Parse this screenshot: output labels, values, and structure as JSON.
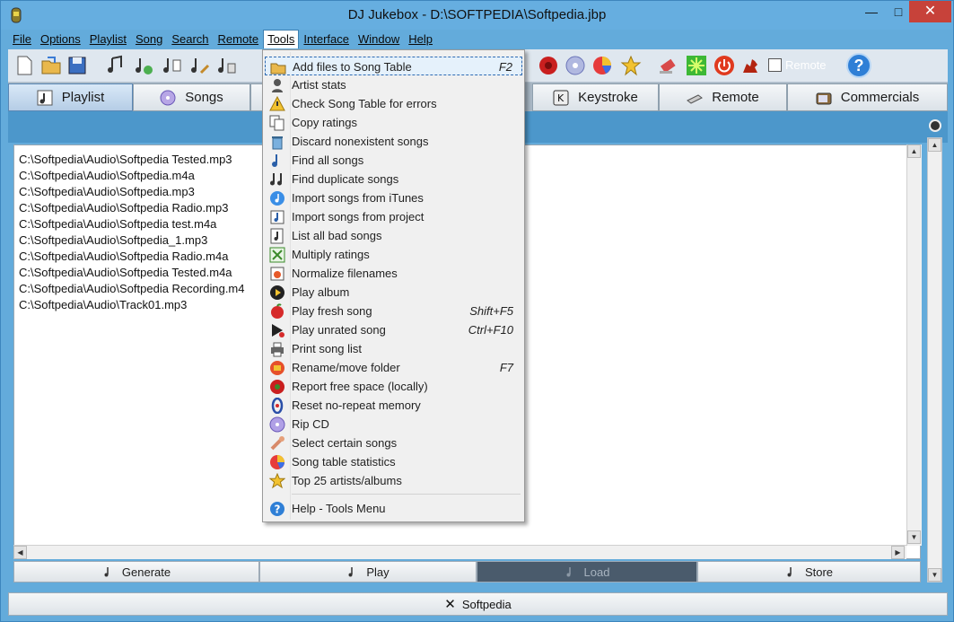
{
  "window": {
    "title": "DJ Jukebox - D:\\SOFTPEDIA\\Softpedia.jbp",
    "minimize": "—",
    "maximize": "□",
    "close": "✕"
  },
  "menubar": {
    "items": [
      "File",
      "Options",
      "Playlist",
      "Song",
      "Search",
      "Remote",
      "Tools",
      "Interface",
      "Window",
      "Help"
    ],
    "active": "Tools"
  },
  "toolbar": {
    "remote_checkbox_label": "Remote",
    "help_glyph": "?"
  },
  "tabs": [
    {
      "label": "Playlist",
      "icon": "playlist-note-icon",
      "selected": true
    },
    {
      "label": "Songs",
      "icon": "cd-icon",
      "selected": false
    },
    {
      "label": "Keystroke",
      "icon": "keystroke-key-icon",
      "selected": false
    },
    {
      "label": "Remote",
      "icon": "remote-device-icon",
      "selected": false
    },
    {
      "label": "Commercials",
      "icon": "tv-icon",
      "selected": false
    }
  ],
  "playlist": {
    "items": [
      "C:\\Softpedia\\Audio\\Softpedia Tested.mp3",
      "C:\\Softpedia\\Audio\\Softpedia.m4a",
      "C:\\Softpedia\\Audio\\Softpedia.mp3",
      "C:\\Softpedia\\Audio\\Softpedia Radio.mp3",
      "C:\\Softpedia\\Audio\\Softpedia test.m4a",
      "C:\\Softpedia\\Audio\\Softpedia_1.mp3",
      "C:\\Softpedia\\Audio\\Softpedia Radio.m4a",
      "C:\\Softpedia\\Audio\\Softpedia Tested.m4a",
      "C:\\Softpedia\\Audio\\Softpedia Recording.m4",
      "C:\\Softpedia\\Audio\\Track01.mp3"
    ]
  },
  "bottom_buttons": [
    {
      "label": "Generate",
      "enabled": true
    },
    {
      "label": "Play",
      "enabled": true
    },
    {
      "label": "Load",
      "enabled": false
    },
    {
      "label": "Store",
      "enabled": true
    }
  ],
  "status": {
    "label": "Softpedia",
    "close_glyph": "✕"
  },
  "tools_menu": {
    "items": [
      {
        "label": "Add files to Song Table",
        "shortcut": "F2",
        "icon": "folder-open-icon",
        "highlighted": true
      },
      {
        "label": "Artist stats",
        "shortcut": "",
        "icon": "artist-stats-icon"
      },
      {
        "label": "Check Song Table for errors",
        "shortcut": "",
        "icon": "warning-check-icon"
      },
      {
        "label": "Copy ratings",
        "shortcut": "",
        "icon": "copy-ratings-icon"
      },
      {
        "label": "Discard nonexistent songs",
        "shortcut": "",
        "icon": "trash-icon"
      },
      {
        "label": "Find all songs",
        "shortcut": "",
        "icon": "find-note-icon"
      },
      {
        "label": "Find duplicate songs",
        "shortcut": "",
        "icon": "duplicate-notes-icon"
      },
      {
        "label": "Import songs from iTunes",
        "shortcut": "",
        "icon": "itunes-icon"
      },
      {
        "label": "Import songs from project",
        "shortcut": "",
        "icon": "import-project-icon"
      },
      {
        "label": "List all bad songs",
        "shortcut": "",
        "icon": "bad-songs-icon"
      },
      {
        "label": "Multiply ratings",
        "shortcut": "",
        "icon": "multiply-icon"
      },
      {
        "label": "Normalize filenames",
        "shortcut": "",
        "icon": "normalize-icon"
      },
      {
        "label": "Play album",
        "shortcut": "",
        "icon": "play-album-icon"
      },
      {
        "label": "Play fresh song",
        "shortcut": "Shift+F5",
        "icon": "apple-icon"
      },
      {
        "label": "Play unrated song",
        "shortcut": "Ctrl+F10",
        "icon": "unrated-play-icon"
      },
      {
        "label": "Print song list",
        "shortcut": "",
        "icon": "printer-icon"
      },
      {
        "label": "Rename/move folder",
        "shortcut": "F7",
        "icon": "rename-folder-icon"
      },
      {
        "label": "Report free space (locally)",
        "shortcut": "",
        "icon": "free-space-icon"
      },
      {
        "label": "Reset no-repeat memory",
        "shortcut": "",
        "icon": "reset-memory-icon"
      },
      {
        "label": "Rip CD",
        "shortcut": "",
        "icon": "rip-cd-icon"
      },
      {
        "label": "Select certain songs",
        "shortcut": "",
        "icon": "select-songs-icon"
      },
      {
        "label": "Song table statistics",
        "shortcut": "",
        "icon": "pie-chart-icon"
      },
      {
        "label": "Top 25 artists/albums",
        "shortcut": "",
        "icon": "star-icon"
      }
    ],
    "help_item": {
      "label": "Help - Tools Menu",
      "icon": "help-icon"
    }
  },
  "colors": {
    "window_blue": "#63abdb",
    "strip_blue": "#4c97cb",
    "close_red": "#c7423a",
    "menu_bg": "#f0f0f0",
    "highlight": "#e5f1fb"
  }
}
